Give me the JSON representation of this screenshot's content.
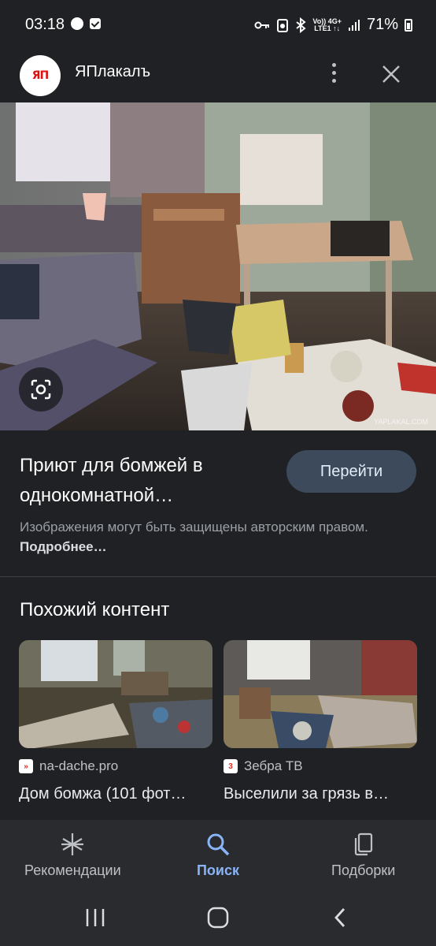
{
  "status_bar": {
    "time": "03:18",
    "battery": "71%",
    "network_top": "Vo)) 4G+",
    "network_bottom": "LTE1 ↑↓"
  },
  "header": {
    "site_name": "ЯПлакалъ",
    "logo_text": "ЯП"
  },
  "main_image": {
    "watermark": "YAPLAKAL.COM",
    "description_icon": "lens-icon"
  },
  "result": {
    "title": "Приют для бомжей в однокомнатной…",
    "goto_label": "Перейти",
    "copyright_text": "Изображения могут быть защищены авторским правом.",
    "copyright_link": "Подробнее…"
  },
  "related": {
    "heading": "Похожий контент",
    "cards": [
      {
        "source": "na-dache.pro",
        "title": "Дом бомжа (101 фот…",
        "favicon_color": "#d93025"
      },
      {
        "source": "Зебра ТВ",
        "title": "Выселили за грязь в…",
        "favicon_color": "#ffffff"
      }
    ]
  },
  "bottom_nav": {
    "items": [
      {
        "label": "Рекомендации",
        "icon": "asterisk-icon"
      },
      {
        "label": "Поиск",
        "icon": "search-icon"
      },
      {
        "label": "Подборки",
        "icon": "collections-icon"
      }
    ],
    "active_index": 1
  },
  "colors": {
    "background": "#202124",
    "accent": "#8ab4f8",
    "button_bg": "#3c4a5c"
  }
}
